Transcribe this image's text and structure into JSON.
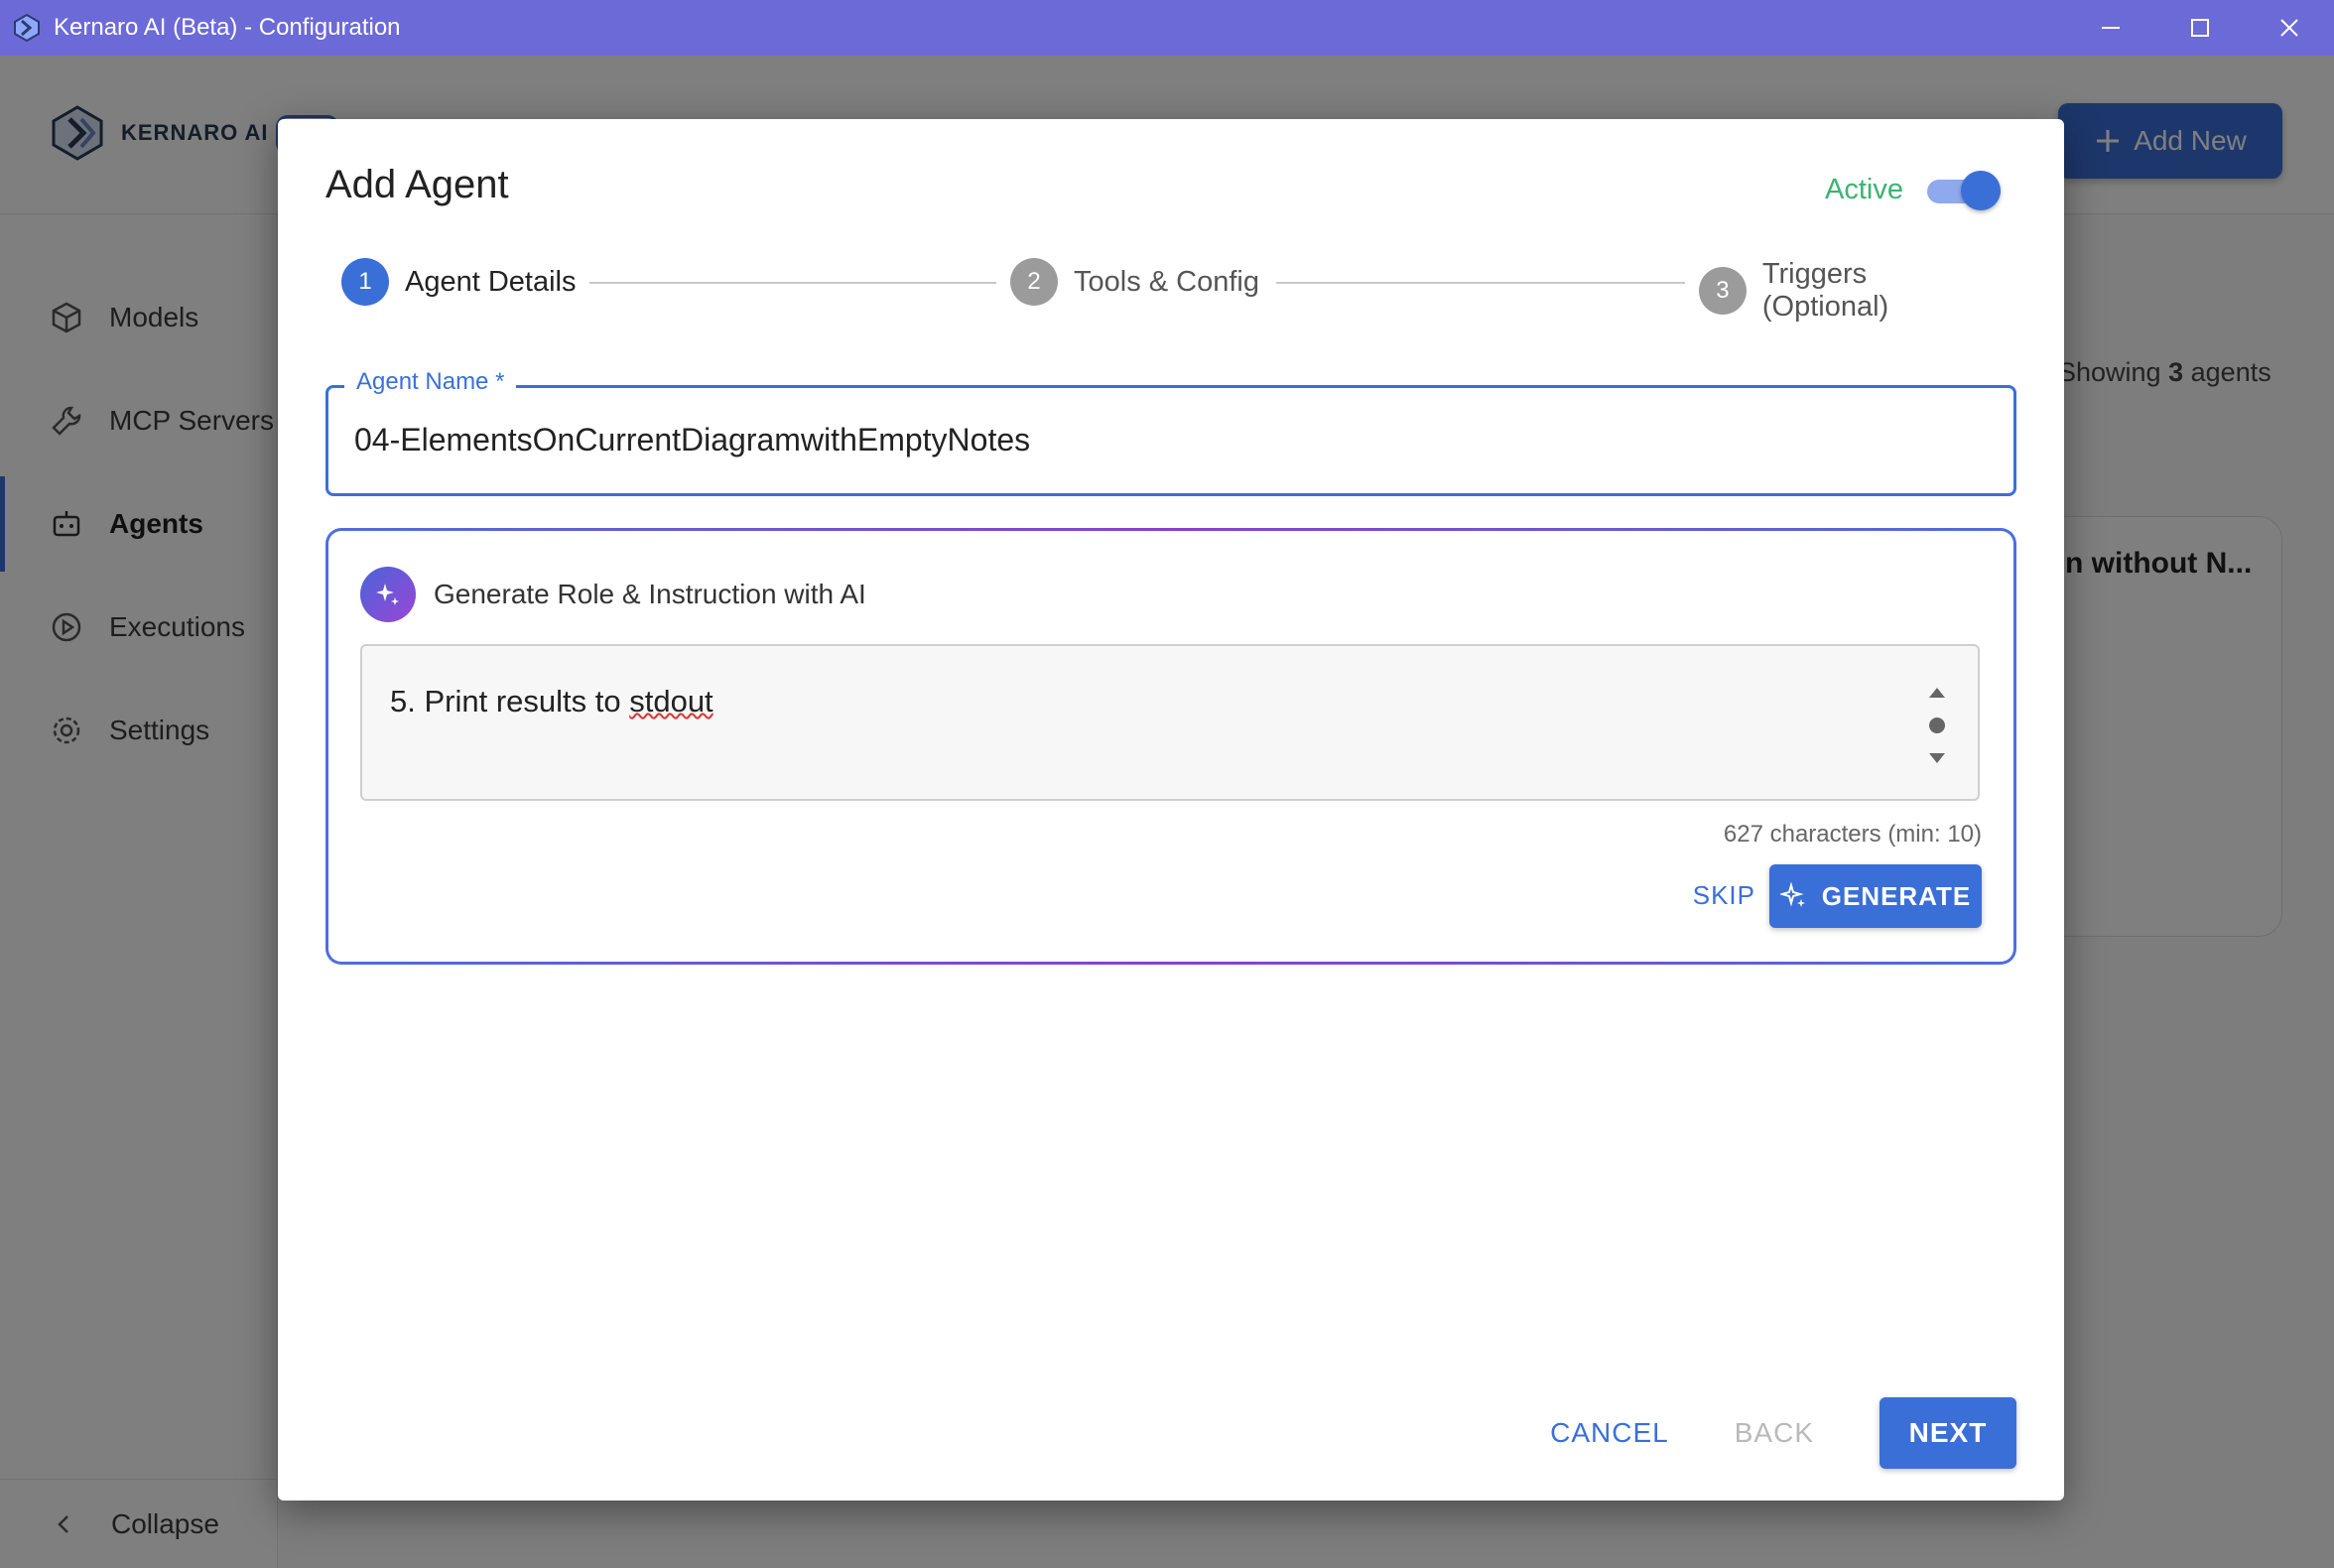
{
  "window": {
    "title": "Kernaro AI (Beta) - Configuration",
    "controls": [
      "minimize-icon",
      "maximize-icon",
      "close-icon"
    ]
  },
  "app": {
    "logo_text": "KERNARO AI",
    "add_new_label": "Add New",
    "sidebar": {
      "items": [
        {
          "label": "Models",
          "icon": "cube-icon",
          "active": false
        },
        {
          "label": "MCP Servers",
          "icon": "wrench-icon",
          "active": false
        },
        {
          "label": "Agents",
          "icon": "robot-icon",
          "active": true
        },
        {
          "label": "Executions",
          "icon": "play-circle-icon",
          "active": false
        },
        {
          "label": "Settings",
          "icon": "gear-icon",
          "active": false
        }
      ],
      "collapse_label": "Collapse"
    },
    "showing": {
      "prefix": "Showing",
      "count": "3",
      "suffix": "agents"
    },
    "card_title": "n without N..."
  },
  "dialog": {
    "title": "Add Agent",
    "active_label": "Active",
    "active_on": true,
    "steps": [
      {
        "number": "1",
        "label": "Agent Details",
        "active": true
      },
      {
        "number": "2",
        "label": "Tools & Config",
        "active": false
      },
      {
        "number": "3",
        "label": "Triggers (Optional)",
        "active": false
      }
    ],
    "agent_name": {
      "label": "Agent Name *",
      "value": "04-ElementsOnCurrentDiagramwithEmptyNotes"
    },
    "generator": {
      "heading": "Generate Role & Instruction with AI",
      "text_prefix": "5. Print results to ",
      "text_misspelled": "stdout",
      "char_count": "627 characters (min: 10)",
      "skip_label": "SKIP",
      "generate_label": "GENERATE"
    },
    "footer": {
      "cancel_label": "CANCEL",
      "back_label": "BACK",
      "next_label": "NEXT"
    }
  },
  "colors": {
    "titlebar": "#6c6ad6",
    "accent": "#3a6fd8",
    "active_green": "#3cb371"
  }
}
